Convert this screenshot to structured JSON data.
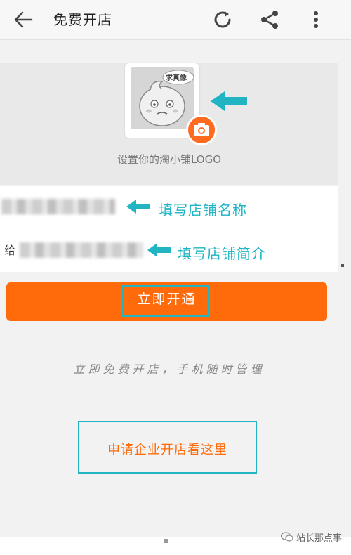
{
  "appbar": {
    "title": "免费开店",
    "icons": [
      "back-arrow-icon",
      "refresh-icon",
      "share-icon",
      "more-vert-icon"
    ]
  },
  "logo_section": {
    "avatar_bubble": "求真像",
    "caption": "设置你的淘小铺LOGO"
  },
  "form": {
    "intro_first_char": "给",
    "annotation_name": "填写店铺名称",
    "annotation_intro": "填写店铺简介"
  },
  "open_button": {
    "label": "立即开通"
  },
  "slogan": "立即免费开店，手机随时管理",
  "enterprise_button": {
    "label": "申请企业开店看这里"
  },
  "watermark": "站长那点事",
  "colors": {
    "accent": "#ff6a0a",
    "annotation": "#21b5c4"
  }
}
